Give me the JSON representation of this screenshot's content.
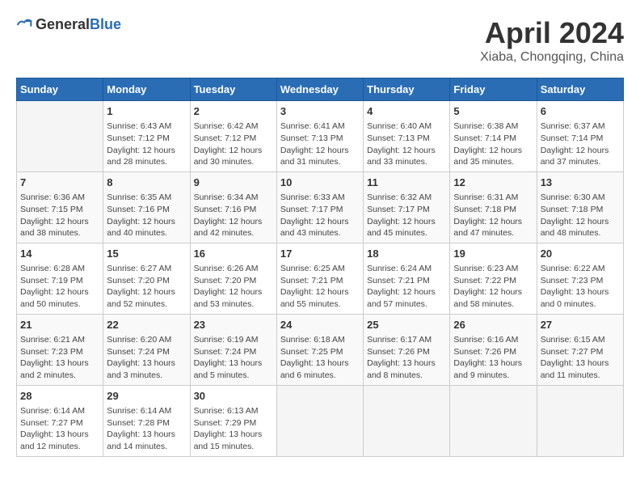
{
  "header": {
    "logo_general": "General",
    "logo_blue": "Blue",
    "month": "April 2024",
    "location": "Xiaba, Chongqing, China"
  },
  "days_of_week": [
    "Sunday",
    "Monday",
    "Tuesday",
    "Wednesday",
    "Thursday",
    "Friday",
    "Saturday"
  ],
  "weeks": [
    [
      {
        "day": "",
        "empty": true
      },
      {
        "day": "1",
        "sunrise": "6:43 AM",
        "sunset": "7:12 PM",
        "daylight": "12 hours and 28 minutes."
      },
      {
        "day": "2",
        "sunrise": "6:42 AM",
        "sunset": "7:12 PM",
        "daylight": "12 hours and 30 minutes."
      },
      {
        "day": "3",
        "sunrise": "6:41 AM",
        "sunset": "7:13 PM",
        "daylight": "12 hours and 31 minutes."
      },
      {
        "day": "4",
        "sunrise": "6:40 AM",
        "sunset": "7:13 PM",
        "daylight": "12 hours and 33 minutes."
      },
      {
        "day": "5",
        "sunrise": "6:38 AM",
        "sunset": "7:14 PM",
        "daylight": "12 hours and 35 minutes."
      },
      {
        "day": "6",
        "sunrise": "6:37 AM",
        "sunset": "7:14 PM",
        "daylight": "12 hours and 37 minutes."
      }
    ],
    [
      {
        "day": "7",
        "sunrise": "6:36 AM",
        "sunset": "7:15 PM",
        "daylight": "12 hours and 38 minutes."
      },
      {
        "day": "8",
        "sunrise": "6:35 AM",
        "sunset": "7:16 PM",
        "daylight": "12 hours and 40 minutes."
      },
      {
        "day": "9",
        "sunrise": "6:34 AM",
        "sunset": "7:16 PM",
        "daylight": "12 hours and 42 minutes."
      },
      {
        "day": "10",
        "sunrise": "6:33 AM",
        "sunset": "7:17 PM",
        "daylight": "12 hours and 43 minutes."
      },
      {
        "day": "11",
        "sunrise": "6:32 AM",
        "sunset": "7:17 PM",
        "daylight": "12 hours and 45 minutes."
      },
      {
        "day": "12",
        "sunrise": "6:31 AM",
        "sunset": "7:18 PM",
        "daylight": "12 hours and 47 minutes."
      },
      {
        "day": "13",
        "sunrise": "6:30 AM",
        "sunset": "7:18 PM",
        "daylight": "12 hours and 48 minutes."
      }
    ],
    [
      {
        "day": "14",
        "sunrise": "6:28 AM",
        "sunset": "7:19 PM",
        "daylight": "12 hours and 50 minutes."
      },
      {
        "day": "15",
        "sunrise": "6:27 AM",
        "sunset": "7:20 PM",
        "daylight": "12 hours and 52 minutes."
      },
      {
        "day": "16",
        "sunrise": "6:26 AM",
        "sunset": "7:20 PM",
        "daylight": "12 hours and 53 minutes."
      },
      {
        "day": "17",
        "sunrise": "6:25 AM",
        "sunset": "7:21 PM",
        "daylight": "12 hours and 55 minutes."
      },
      {
        "day": "18",
        "sunrise": "6:24 AM",
        "sunset": "7:21 PM",
        "daylight": "12 hours and 57 minutes."
      },
      {
        "day": "19",
        "sunrise": "6:23 AM",
        "sunset": "7:22 PM",
        "daylight": "12 hours and 58 minutes."
      },
      {
        "day": "20",
        "sunrise": "6:22 AM",
        "sunset": "7:23 PM",
        "daylight": "13 hours and 0 minutes."
      }
    ],
    [
      {
        "day": "21",
        "sunrise": "6:21 AM",
        "sunset": "7:23 PM",
        "daylight": "13 hours and 2 minutes."
      },
      {
        "day": "22",
        "sunrise": "6:20 AM",
        "sunset": "7:24 PM",
        "daylight": "13 hours and 3 minutes."
      },
      {
        "day": "23",
        "sunrise": "6:19 AM",
        "sunset": "7:24 PM",
        "daylight": "13 hours and 5 minutes."
      },
      {
        "day": "24",
        "sunrise": "6:18 AM",
        "sunset": "7:25 PM",
        "daylight": "13 hours and 6 minutes."
      },
      {
        "day": "25",
        "sunrise": "6:17 AM",
        "sunset": "7:26 PM",
        "daylight": "13 hours and 8 minutes."
      },
      {
        "day": "26",
        "sunrise": "6:16 AM",
        "sunset": "7:26 PM",
        "daylight": "13 hours and 9 minutes."
      },
      {
        "day": "27",
        "sunrise": "6:15 AM",
        "sunset": "7:27 PM",
        "daylight": "13 hours and 11 minutes."
      }
    ],
    [
      {
        "day": "28",
        "sunrise": "6:14 AM",
        "sunset": "7:27 PM",
        "daylight": "13 hours and 12 minutes."
      },
      {
        "day": "29",
        "sunrise": "6:14 AM",
        "sunset": "7:28 PM",
        "daylight": "13 hours and 14 minutes."
      },
      {
        "day": "30",
        "sunrise": "6:13 AM",
        "sunset": "7:29 PM",
        "daylight": "13 hours and 15 minutes."
      },
      {
        "day": "",
        "empty": true
      },
      {
        "day": "",
        "empty": true
      },
      {
        "day": "",
        "empty": true
      },
      {
        "day": "",
        "empty": true
      }
    ]
  ],
  "labels": {
    "sunrise_prefix": "Sunrise: ",
    "sunset_prefix": "Sunset: ",
    "daylight_prefix": "Daylight: "
  }
}
